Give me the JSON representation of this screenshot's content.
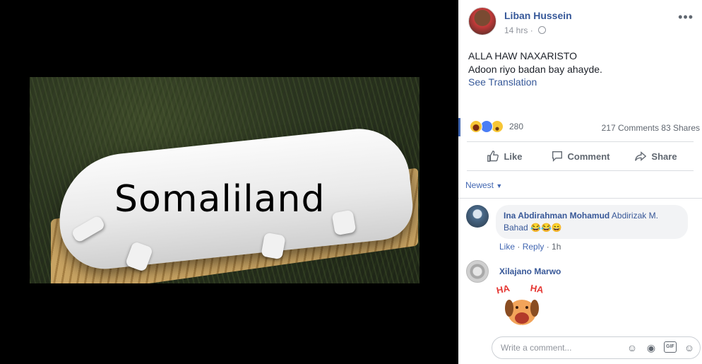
{
  "photo": {
    "overlay_text": "Somaliland"
  },
  "post": {
    "author": "Liban Hussein",
    "time": "14 hrs",
    "more_icon": "•••",
    "text_line1": "ALLA HAW NAXARISTO",
    "text_line2": "Adoon riyo badan bay ahayde.",
    "see_translation": "See Translation"
  },
  "stats": {
    "reaction_count": "280",
    "comments": "217 Comments",
    "shares": "83 Shares"
  },
  "actions": {
    "like": "Like",
    "comment": "Comment",
    "share": "Share"
  },
  "sort": {
    "label": "Newest"
  },
  "comments": [
    {
      "name": "Ina Abdirahman Mohamud",
      "tag_line1": "Abdirizak M.",
      "tag_line2": "Bahad",
      "emoji": "😂😂😄",
      "like": "Like",
      "reply": "Reply",
      "sep": " · ",
      "time": "1h"
    },
    {
      "name": "Xilajano Marwo",
      "sticker_text": "HA HA"
    }
  ],
  "composer": {
    "placeholder": "Write a comment..."
  },
  "colors": {
    "link": "#365899",
    "accent": "#4267b2",
    "bg": "#000000"
  }
}
